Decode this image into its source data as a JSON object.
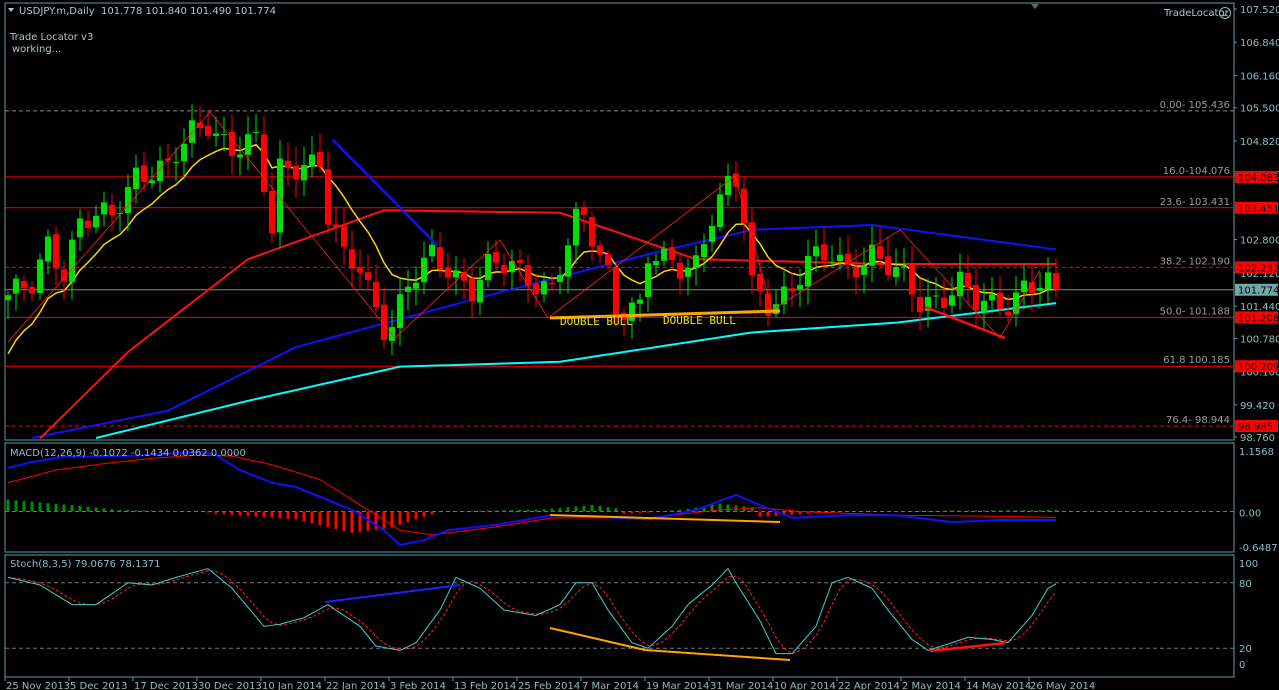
{
  "header": {
    "symbol": "USDJPY.m,Daily",
    "ohlc": "101.778 101.840 101.490 101.774",
    "indicator_name": "Trade Locator v3",
    "indicator_status": "working...",
    "trade_locator_label": "TradeLocator",
    "trade_locator_icon": "sad-face-icon"
  },
  "colors": {
    "bull": "#00e000",
    "bear": "#ff0000",
    "ma_fast": "#ffd700",
    "ma_mid": "#ff1010",
    "ma_slow": "#1010ff",
    "ma_long": "#00ffff",
    "axis": "#5f9ea0",
    "orange": "#ffa500"
  },
  "price_axis": [
    "107.520",
    "106.840",
    "106.160",
    "105.500",
    "104.820",
    "104.140",
    "102.800",
    "102.120",
    "101.440",
    "100.780",
    "100.100",
    "99.420",
    "98.760"
  ],
  "fib_levels": [
    {
      "label": "0.00- 105.436",
      "price": 105.436,
      "tag": null,
      "style": "gray-dash"
    },
    {
      "label": "16.0-104.076",
      "price": 104.083,
      "tag": "104.083",
      "style": "red"
    },
    {
      "label": "23.6- 103.431",
      "price": 103.451,
      "tag": "103.451",
      "style": "red"
    },
    {
      "label": "38.2- 102.190",
      "price": 102.233,
      "tag": "102.233",
      "style": "red-dash"
    },
    {
      "label": "50.0- 101.188",
      "price": 101.208,
      "tag": "101.208",
      "style": "red"
    },
    {
      "label": "61.8 100.185",
      "price": 100.209,
      "tag": "100.209",
      "style": "red"
    },
    {
      "label": "76.4- 98.944",
      "price": 98.985,
      "tag": "98.985",
      "style": "red-dash"
    }
  ],
  "current_price": {
    "value": 101.774,
    "tag": "101.774"
  },
  "annotations": [
    "DOUBLE BULL",
    "DOUBLE BULL"
  ],
  "dates": [
    "25 Nov 2013",
    "5 Dec 2013",
    "17 Dec 2013",
    "30 Dec 2013",
    "10 Jan 2014",
    "22 Jan 2014",
    "3 Feb 2014",
    "13 Feb 2014",
    "25 Feb 2014",
    "7 Mar 2014",
    "19 Mar 2014",
    "31 Mar 2014",
    "10 Apr 2014",
    "22 Apr 2014",
    "2 May 2014",
    "14 May 2014",
    "26 May 2014"
  ],
  "macd": {
    "label": "MACD(12,26,9) -0.1072 -0.1434 0.0362 0.0000",
    "axis": [
      "1.1568",
      "0.00",
      "-0.6487"
    ]
  },
  "stoch": {
    "label": "Stoch(8,3,5) 79.0676 78.1371",
    "axis": [
      "100",
      "80",
      "20",
      "0"
    ]
  },
  "chart_data": {
    "type": "candlestick",
    "price_range": [
      98.76,
      107.52
    ],
    "bars": 132,
    "close_keypoints": [
      [
        0,
        101.56
      ],
      [
        3,
        101.87
      ],
      [
        5,
        102.79
      ],
      [
        7,
        102.18
      ],
      [
        9,
        103.1
      ],
      [
        13,
        103.3
      ],
      [
        16,
        104.2
      ],
      [
        20,
        104.2
      ],
      [
        23,
        105.0
      ],
      [
        25,
        105.25
      ],
      [
        27,
        104.84
      ],
      [
        28,
        104.64
      ],
      [
        31,
        104.74
      ],
      [
        33,
        103.0
      ],
      [
        34,
        104.3
      ],
      [
        37,
        104.4
      ],
      [
        39,
        104.3
      ],
      [
        40,
        103.2
      ],
      [
        42,
        102.4
      ],
      [
        44,
        102.3
      ],
      [
        47,
        101.05
      ],
      [
        48,
        101.05
      ],
      [
        50,
        101.77
      ],
      [
        53,
        102.49
      ],
      [
        55,
        102.28
      ],
      [
        58,
        101.77
      ],
      [
        60,
        102.18
      ],
      [
        63,
        102.28
      ],
      [
        65,
        102.08
      ],
      [
        68,
        101.77
      ],
      [
        71,
        103.1
      ],
      [
        72,
        103.2
      ],
      [
        75,
        102.18
      ],
      [
        76,
        101.46
      ],
      [
        79,
        101.36
      ],
      [
        80,
        102.38
      ],
      [
        84,
        102.28
      ],
      [
        86,
        102.38
      ],
      [
        88,
        103.3
      ],
      [
        90,
        103.82
      ],
      [
        91,
        103.92
      ],
      [
        92,
        103.2
      ],
      [
        93,
        101.87
      ],
      [
        95,
        101.56
      ],
      [
        98,
        101.77
      ],
      [
        100,
        102.28
      ],
      [
        103,
        102.49
      ],
      [
        105,
        102.28
      ],
      [
        108,
        102.49
      ],
      [
        110,
        102.18
      ],
      [
        112,
        101.97
      ],
      [
        114,
        101.56
      ],
      [
        117,
        101.66
      ],
      [
        119,
        101.87
      ],
      [
        121,
        101.46
      ],
      [
        123,
        101.46
      ],
      [
        125,
        101.56
      ],
      [
        127,
        101.87
      ],
      [
        129,
        101.87
      ],
      [
        131,
        101.774
      ]
    ],
    "ma_mid_keypoints": [
      [
        4,
        98.73
      ],
      [
        15,
        100.5
      ],
      [
        30,
        102.4
      ],
      [
        47,
        103.4
      ],
      [
        69,
        103.35
      ],
      [
        86,
        102.4
      ],
      [
        110,
        102.3
      ],
      [
        131,
        102.3
      ]
    ],
    "ma_slow_keypoints": [
      [
        3,
        98.74
      ],
      [
        20,
        99.3
      ],
      [
        36,
        100.6
      ],
      [
        61,
        101.7
      ],
      [
        80,
        102.5
      ],
      [
        93,
        103.0
      ],
      [
        108,
        103.1
      ],
      [
        131,
        102.6
      ]
    ],
    "ma_long_keypoints": [
      [
        11,
        98.74
      ],
      [
        30,
        99.5
      ],
      [
        49,
        100.2
      ],
      [
        69,
        100.3
      ],
      [
        93,
        100.9
      ],
      [
        111,
        101.1
      ],
      [
        131,
        101.5
      ]
    ],
    "macd_main": [
      [
        0,
        0.82
      ],
      [
        3,
        0.93
      ],
      [
        7,
        1.03
      ],
      [
        16,
        1.05
      ],
      [
        24,
        1.12
      ],
      [
        26,
        1.06
      ],
      [
        29,
        0.78
      ],
      [
        33,
        0.54
      ],
      [
        36,
        0.46
      ],
      [
        43,
        0.03
      ],
      [
        47,
        -0.35
      ],
      [
        49,
        -0.63
      ],
      [
        52,
        -0.54
      ],
      [
        55,
        -0.35
      ],
      [
        61,
        -0.25
      ],
      [
        68,
        -0.07
      ],
      [
        74,
        -0.1
      ],
      [
        80,
        -0.15
      ],
      [
        86,
        0.03
      ],
      [
        91,
        0.31
      ],
      [
        94,
        0.12
      ],
      [
        98,
        -0.12
      ],
      [
        105,
        -0.07
      ],
      [
        111,
        -0.07
      ],
      [
        118,
        -0.2
      ],
      [
        124,
        -0.16
      ],
      [
        131,
        -0.16
      ]
    ],
    "macd_signal": [
      [
        0,
        0.54
      ],
      [
        6,
        0.78
      ],
      [
        12,
        0.9
      ],
      [
        18,
        1.0
      ],
      [
        24,
        1.06
      ],
      [
        28,
        1.04
      ],
      [
        33,
        0.88
      ],
      [
        39,
        0.6
      ],
      [
        43,
        0.22
      ],
      [
        49,
        -0.35
      ],
      [
        53,
        -0.44
      ],
      [
        61,
        -0.29
      ],
      [
        68,
        -0.12
      ],
      [
        80,
        -0.12
      ],
      [
        89,
        0.03
      ],
      [
        94,
        0.07
      ],
      [
        99,
        0.0
      ],
      [
        111,
        -0.07
      ],
      [
        124,
        -0.09
      ],
      [
        131,
        -0.11
      ]
    ],
    "macd_hist": [
      [
        0,
        0.22
      ],
      [
        8,
        0.12
      ],
      [
        14,
        0.03
      ],
      [
        24,
        0.0
      ],
      [
        27,
        -0.05
      ],
      [
        36,
        -0.15
      ],
      [
        43,
        -0.4
      ],
      [
        48,
        -0.3
      ],
      [
        54,
        0.0
      ],
      [
        67,
        0.04
      ],
      [
        73,
        0.12
      ],
      [
        76,
        0.06
      ],
      [
        77,
        -0.04
      ],
      [
        80,
        -0.02
      ],
      [
        85,
        0.05
      ],
      [
        89,
        0.15
      ],
      [
        93,
        0.08
      ],
      [
        94,
        -0.1
      ],
      [
        99,
        -0.05
      ],
      [
        103,
        0.0
      ],
      [
        131,
        0.03
      ]
    ],
    "stoch_main": [
      [
        0,
        85
      ],
      [
        4,
        78
      ],
      [
        8,
        60
      ],
      [
        11,
        60
      ],
      [
        15,
        80
      ],
      [
        18,
        78
      ],
      [
        21,
        85
      ],
      [
        25,
        93
      ],
      [
        28,
        75
      ],
      [
        32,
        40
      ],
      [
        34,
        42
      ],
      [
        37,
        48
      ],
      [
        40,
        60
      ],
      [
        44,
        40
      ],
      [
        46,
        22
      ],
      [
        49,
        18
      ],
      [
        51,
        25
      ],
      [
        54,
        55
      ],
      [
        56,
        85
      ],
      [
        59,
        75
      ],
      [
        62,
        55
      ],
      [
        66,
        50
      ],
      [
        69,
        60
      ],
      [
        71,
        80
      ],
      [
        73,
        80
      ],
      [
        75,
        55
      ],
      [
        78,
        25
      ],
      [
        80,
        20
      ],
      [
        83,
        40
      ],
      [
        85,
        60
      ],
      [
        88,
        78
      ],
      [
        90,
        93
      ],
      [
        91,
        80
      ],
      [
        94,
        45
      ],
      [
        96,
        15
      ],
      [
        98,
        15
      ],
      [
        101,
        40
      ],
      [
        103,
        80
      ],
      [
        105,
        85
      ],
      [
        108,
        75
      ],
      [
        110,
        55
      ],
      [
        113,
        28
      ],
      [
        115,
        18
      ],
      [
        118,
        25
      ],
      [
        120,
        30
      ],
      [
        123,
        28
      ],
      [
        125,
        25
      ],
      [
        128,
        50
      ],
      [
        130,
        75
      ],
      [
        131,
        79
      ]
    ]
  }
}
